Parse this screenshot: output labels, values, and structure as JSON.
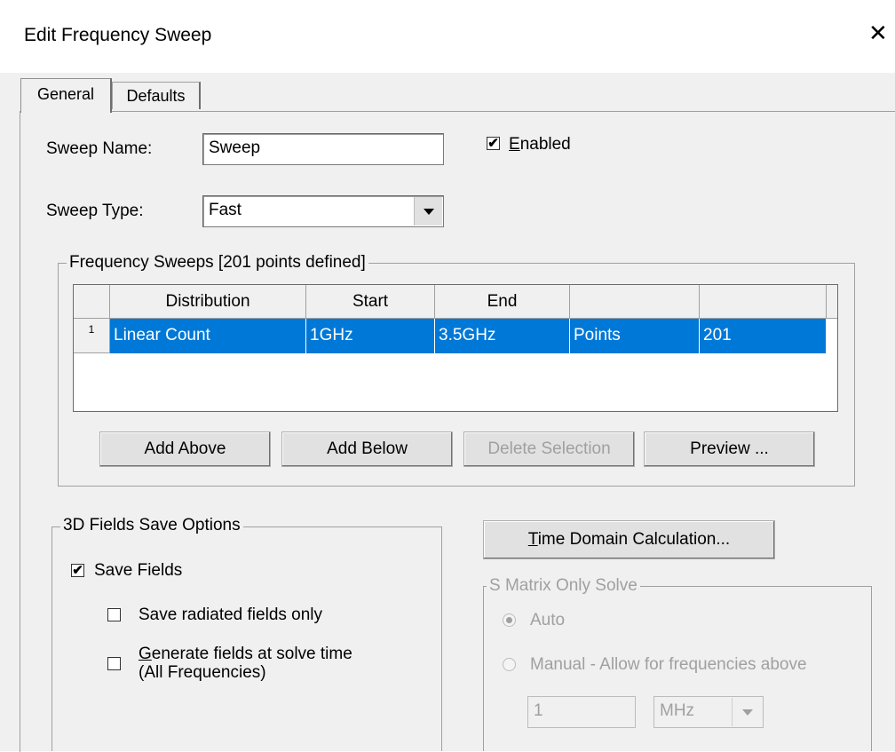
{
  "window": {
    "title": "Edit Frequency Sweep",
    "close_glyph": "✕"
  },
  "tabs": [
    {
      "label": "General",
      "selected": true
    },
    {
      "label": "Defaults",
      "selected": false
    }
  ],
  "sweep_name": {
    "label": "Sweep Name:",
    "value": "Sweep"
  },
  "enabled": {
    "label_mnemonic": "E",
    "label_rest": "nabled",
    "checked": true
  },
  "sweep_type": {
    "label": "Sweep Type:",
    "value": "Fast"
  },
  "freq_sweeps": {
    "title": "Frequency Sweeps [201 points defined]",
    "columns": [
      "Distribution",
      "Start",
      "End",
      "",
      ""
    ],
    "rows": [
      {
        "index": "1",
        "cells": [
          "Linear Count",
          "1GHz",
          "3.5GHz",
          "Points",
          "201"
        ],
        "selected": true
      }
    ],
    "buttons": {
      "add_above": "Add Above",
      "add_below": "Add Below",
      "delete_selection": "Delete Selection",
      "preview": "Preview ..."
    }
  },
  "fields_save": {
    "title": "3D Fields Save Options",
    "save_fields": {
      "label": "Save Fields",
      "checked": true
    },
    "radiated_only": {
      "label": "Save radiated fields only",
      "checked": false
    },
    "generate_at_solve": {
      "label_mnemonic": "G",
      "label_line1_rest": "enerate fields at solve time",
      "label_line2": "(All Frequencies)",
      "checked": false
    }
  },
  "time_domain": {
    "label_mnemonic": "T",
    "label_rest": "ime Domain Calculation..."
  },
  "s_matrix": {
    "title": "S Matrix Only Solve",
    "auto": {
      "label": "Auto",
      "selected": true
    },
    "manual": {
      "label": "Manual -  Allow for frequencies above",
      "selected": false
    },
    "value": "1",
    "unit": "MHz"
  },
  "colors": {
    "selection": "#0078d7",
    "dialog_bg": "#f0f0f0",
    "disabled": "#a0a0a0"
  }
}
